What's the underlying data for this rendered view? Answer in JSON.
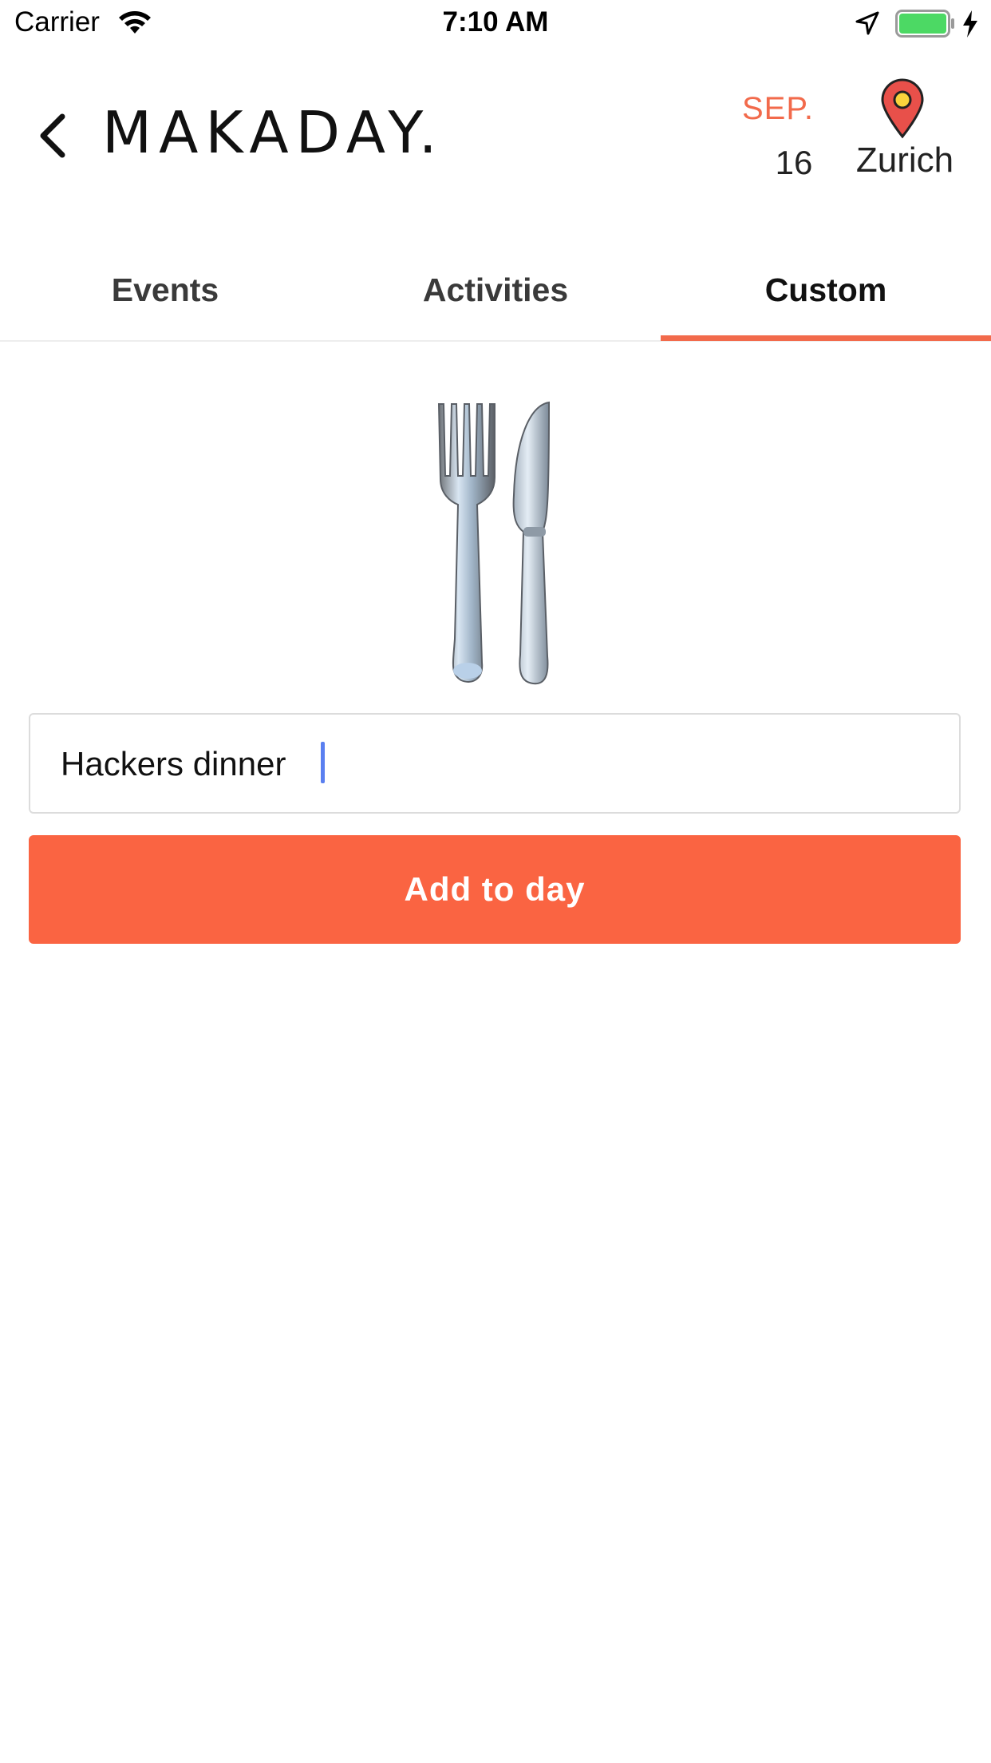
{
  "status_bar": {
    "carrier": "Carrier",
    "time": "7:10 AM",
    "battery_color": "#4cd964"
  },
  "header": {
    "brand": "MAKADAY.",
    "month": "SEP.",
    "day": "16",
    "city": "Zurich",
    "accent_color": "#f26a4b",
    "pin_color": "#e8504a"
  },
  "tabs": [
    {
      "label": "Events",
      "active": false
    },
    {
      "label": "Activities",
      "active": false
    },
    {
      "label": "Custom",
      "active": true
    }
  ],
  "custom": {
    "emoji": "fork-and-knife",
    "input_value": "Hackers dinner",
    "button_label": "Add to day",
    "button_color": "#fa6442"
  }
}
